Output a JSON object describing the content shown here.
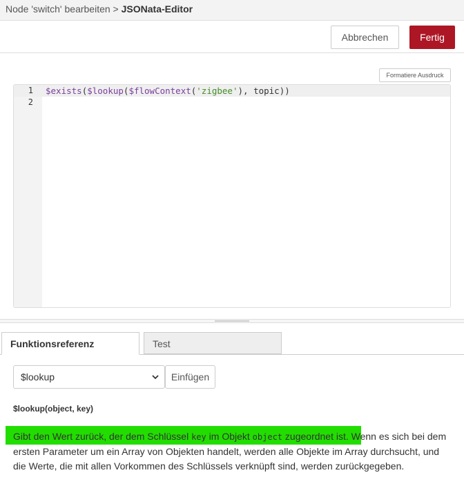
{
  "header": {
    "breadcrumb_prefix": "Node 'switch' bearbeiten",
    "separator": ">",
    "title": "JSONata-Editor"
  },
  "toolbar": {
    "cancel_label": "Abbrechen",
    "done_label": "Fertig",
    "accent_color": "#ad1625"
  },
  "editor": {
    "format_label": "Formatiere Ausdruck",
    "line_numbers": [
      "1",
      "2"
    ],
    "tokens": {
      "fn1": "$exists",
      "p1": "(",
      "fn2": "$lookup",
      "p2": "(",
      "fn3": "$flowContext",
      "p3": "(",
      "str": "'zigbee'",
      "rest": "), topic))"
    },
    "line2": ""
  },
  "tabs": {
    "reference": "Funktionsreferenz",
    "test": "Test"
  },
  "reference": {
    "selected_function": "$lookup",
    "insert_label": "Einfügen",
    "signature": "$lookup(object, key)",
    "description": {
      "t1": "Gibt den Wert zurück, der dem Schlüssel ",
      "c1": "key",
      "t2": " im Objekt ",
      "c2": "object",
      "t3": " zugeordnet ist. Wenn es sich bei dem ersten Parameter um ein Array von Objekten handelt, werden alle Objekte im Array durchsucht, und die Werte, die mit allen Vorkommen des Schlüssels verknüpft sind, werden zurückgegeben."
    },
    "highlight_color": "#22dd00"
  }
}
